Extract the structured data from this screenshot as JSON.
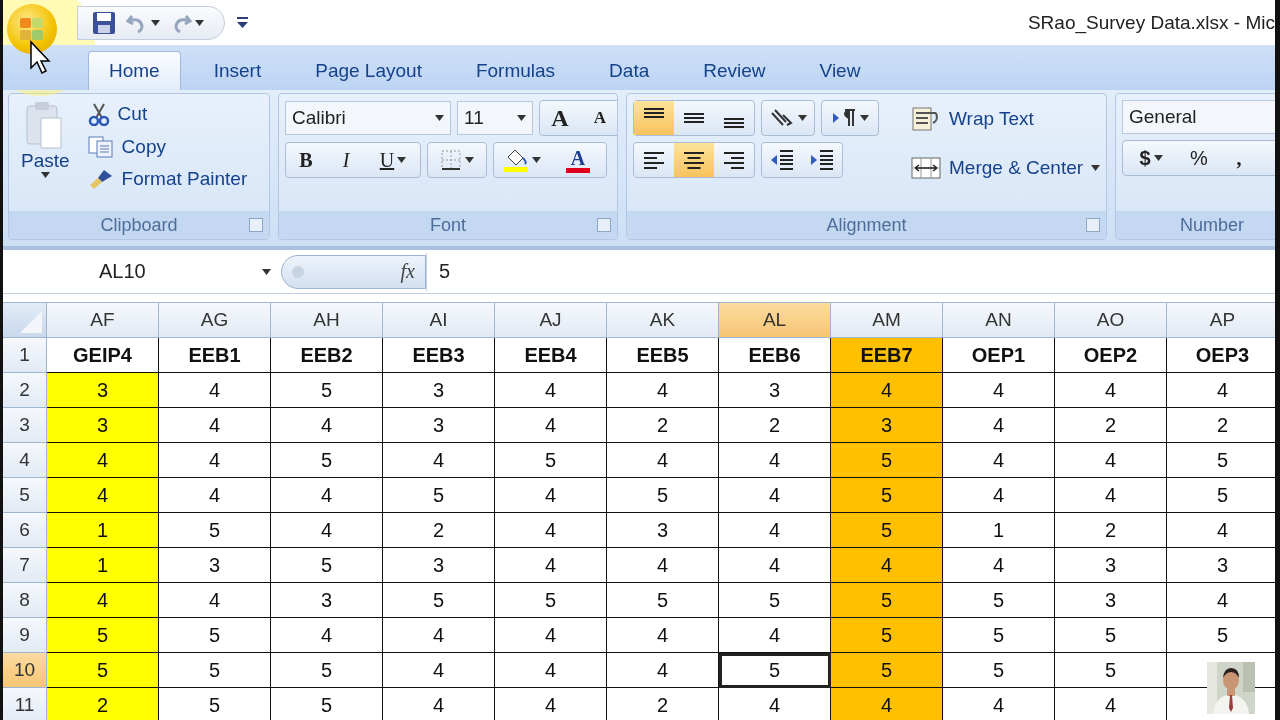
{
  "window": {
    "title": "SRao_Survey Data.xlsx  -  Mic"
  },
  "tabs": [
    {
      "label": "Home",
      "selected": true
    },
    {
      "label": "Insert",
      "selected": false
    },
    {
      "label": "Page Layout",
      "selected": false
    },
    {
      "label": "Formulas",
      "selected": false
    },
    {
      "label": "Data",
      "selected": false
    },
    {
      "label": "Review",
      "selected": false
    },
    {
      "label": "View",
      "selected": false
    }
  ],
  "clipboard": {
    "paste": "Paste",
    "cut": "Cut",
    "copy": "Copy",
    "format_painter": "Format Painter",
    "label": "Clipboard"
  },
  "font": {
    "name": "Calibri",
    "size": "11",
    "grow": "A",
    "shrink": "A",
    "bold": "B",
    "italic": "I",
    "underline": "U",
    "font_color": "A",
    "label": "Font"
  },
  "alignment": {
    "vertical": [
      {
        "kind": "top",
        "selected": true
      },
      {
        "kind": "middle",
        "selected": false
      },
      {
        "kind": "bottom",
        "selected": false
      }
    ],
    "horizontal": [
      {
        "kind": "left",
        "selected": false
      },
      {
        "kind": "center",
        "selected": true
      },
      {
        "kind": "right",
        "selected": false
      }
    ],
    "wrap_text": "Wrap Text",
    "merge_center": "Merge & Center",
    "label": "Alignment"
  },
  "number": {
    "format": "General",
    "currency": "$",
    "percent": "%",
    "comma": ",",
    "label": "Number"
  },
  "formula_bar": {
    "name_box": "AL10",
    "fx": "fx",
    "value": "5"
  },
  "columns": [
    {
      "letter": "AF",
      "selected": false,
      "color": "#ffff00"
    },
    {
      "letter": "AG",
      "selected": false
    },
    {
      "letter": "AH",
      "selected": false
    },
    {
      "letter": "AI",
      "selected": false
    },
    {
      "letter": "AJ",
      "selected": false
    },
    {
      "letter": "AK",
      "selected": false
    },
    {
      "letter": "AL",
      "selected": true
    },
    {
      "letter": "AM",
      "selected": false,
      "color": "#ffc000",
      "header_filled": true
    },
    {
      "letter": "AN",
      "selected": false
    },
    {
      "letter": "AO",
      "selected": false
    },
    {
      "letter": "AP",
      "selected": false
    }
  ],
  "rows": [
    {
      "number": "1",
      "selected": false,
      "cells": [
        "GEIP4",
        "EEB1",
        "EEB2",
        "EEB3",
        "EEB4",
        "EEB5",
        "EEB6",
        "EEB7",
        "OEP1",
        "OEP2",
        "OEP3"
      ]
    },
    {
      "number": "2",
      "selected": false,
      "cells": [
        "3",
        "4",
        "5",
        "3",
        "4",
        "4",
        "3",
        "4",
        "4",
        "4",
        "4"
      ]
    },
    {
      "number": "3",
      "selected": false,
      "cells": [
        "3",
        "4",
        "4",
        "3",
        "4",
        "2",
        "2",
        "3",
        "4",
        "2",
        "2"
      ]
    },
    {
      "number": "4",
      "selected": false,
      "cells": [
        "4",
        "4",
        "5",
        "4",
        "5",
        "4",
        "4",
        "5",
        "4",
        "4",
        "5"
      ]
    },
    {
      "number": "5",
      "selected": false,
      "cells": [
        "4",
        "4",
        "4",
        "5",
        "4",
        "5",
        "4",
        "5",
        "4",
        "4",
        "5"
      ]
    },
    {
      "number": "6",
      "selected": false,
      "cells": [
        "1",
        "5",
        "4",
        "2",
        "4",
        "3",
        "4",
        "5",
        "1",
        "2",
        "4"
      ]
    },
    {
      "number": "7",
      "selected": false,
      "cells": [
        "1",
        "3",
        "5",
        "3",
        "4",
        "4",
        "4",
        "4",
        "4",
        "3",
        "3"
      ]
    },
    {
      "number": "8",
      "selected": false,
      "cells": [
        "4",
        "4",
        "3",
        "5",
        "5",
        "5",
        "5",
        "5",
        "5",
        "3",
        "4"
      ]
    },
    {
      "number": "9",
      "selected": false,
      "cells": [
        "5",
        "5",
        "4",
        "4",
        "4",
        "4",
        "4",
        "5",
        "5",
        "5",
        "5"
      ]
    },
    {
      "number": "10",
      "selected": true,
      "cells": [
        "5",
        "5",
        "5",
        "4",
        "4",
        "4",
        "5",
        "5",
        "5",
        "5"
      ]
    },
    {
      "number": "11",
      "selected": false,
      "cells": [
        "2",
        "5",
        "5",
        "4",
        "4",
        "2",
        "4",
        "4",
        "4",
        "4"
      ]
    }
  ]
}
